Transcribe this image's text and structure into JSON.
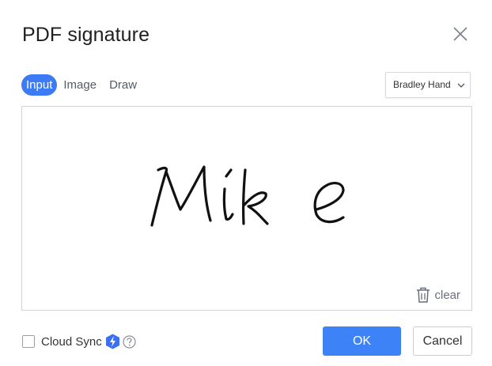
{
  "dialog": {
    "title": "PDF signature",
    "close_icon": "close-icon"
  },
  "tabs": [
    {
      "label": "Input",
      "active": true
    },
    {
      "label": "Image",
      "active": false
    },
    {
      "label": "Draw",
      "active": false
    }
  ],
  "font_select": {
    "value": "Bradley Hand",
    "icon": "chevron-down-icon"
  },
  "signature": {
    "text": "Mike"
  },
  "canvas": {
    "clear_label": "clear",
    "clear_icon": "trash-icon"
  },
  "footer": {
    "cloud_sync_label": "Cloud Sync",
    "cloud_sync_checked": false,
    "bolt_icon": "lightning-icon",
    "help_icon": "question-circle-icon",
    "ok_label": "OK",
    "cancel_label": "Cancel"
  },
  "colors": {
    "accent": "#3c7bf5",
    "ok_button": "#3d82f7",
    "border": "#cfd3d8"
  }
}
